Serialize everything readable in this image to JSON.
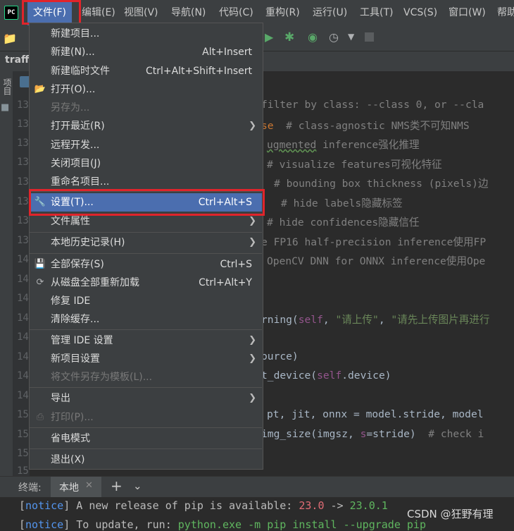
{
  "app": {
    "logo": "PC"
  },
  "menubar": {
    "items": [
      "文件(F)",
      "编辑(E)",
      "视图(V)",
      "导航(N)",
      "代码(C)",
      "重构(R)",
      "运行(U)",
      "工具(T)",
      "VCS(S)",
      "窗口(W)",
      "帮助"
    ]
  },
  "nav": {
    "project": "traff"
  },
  "sidebar": {
    "project_tab": "项目"
  },
  "gutter": {
    "lines": [
      "13",
      "13",
      "13",
      "13",
      "13",
      "13",
      "13",
      "13",
      "14",
      "14",
      "14",
      "14",
      "14",
      "14",
      "14",
      "14",
      "15",
      "15",
      "15",
      "15"
    ]
  },
  "code": {
    "l1": "filter by class: --class 0, or --cla",
    "l2a": "se",
    "l2b": "  # class-agnostic NMS类不可知NMS",
    "l3a": "ugmented",
    "l3b": " inference强化推理",
    "l4": "# visualize features可视化特征",
    "l5": "# bounding box thickness (pixels)边",
    "l6": "# hide labels隐藏标签",
    "l7": "# hide confidences隐藏信任",
    "l8": "e FP16 half-precision inference使用FP",
    "l9": "OpenCV DNN for ONNX inference使用Ope",
    "l10a": "rning(",
    "l10b": "self",
    "l10c": ", ",
    "l10d": "\"请上传\"",
    "l10e": ", ",
    "l10f": "\"请先上传图片再进行",
    "l11": "ource)",
    "l12a": "t_device(",
    "l12b": "self",
    "l12c": ".device)",
    "l13": "pt, jit, onnx = model.stride, model",
    "l14a": "img_size(imgsz, ",
    "l14b": "s",
    "l14c": "=stride)  ",
    "l14d": "# check i"
  },
  "file_menu": {
    "items": [
      {
        "label": "新建项目...",
        "shortcut": ""
      },
      {
        "label": "新建(N)...",
        "shortcut": "Alt+Insert"
      },
      {
        "label": "新建临时文件",
        "shortcut": "Ctrl+Alt+Shift+Insert"
      },
      {
        "label": "打开(O)...",
        "shortcut": "",
        "icon": "folder-icon"
      },
      {
        "label": "另存为...",
        "shortcut": "",
        "disabled": true
      },
      {
        "label": "打开最近(R)",
        "shortcut": "",
        "submenu": true
      },
      {
        "label": "远程开发...",
        "shortcut": ""
      },
      {
        "label": "关闭项目(J)",
        "shortcut": ""
      },
      {
        "label": "重命名项目...",
        "shortcut": ""
      },
      {
        "label": "设置(T)...",
        "shortcut": "Ctrl+Alt+S",
        "icon": "wrench-icon",
        "selected": true
      },
      {
        "label": "文件属性",
        "shortcut": "",
        "submenu": true
      },
      {
        "label": "本地历史记录(H)",
        "shortcut": "",
        "submenu": true
      },
      {
        "label": "全部保存(S)",
        "shortcut": "Ctrl+S",
        "icon": "save-icon"
      },
      {
        "label": "从磁盘全部重新加载",
        "shortcut": "Ctrl+Alt+Y",
        "icon": "reload-icon"
      },
      {
        "label": "修复 IDE",
        "shortcut": ""
      },
      {
        "label": "清除缓存...",
        "shortcut": ""
      },
      {
        "label": "管理 IDE 设置",
        "shortcut": "",
        "submenu": true
      },
      {
        "label": "新项目设置",
        "shortcut": "",
        "submenu": true
      },
      {
        "label": "将文件另存为模板(L)...",
        "shortcut": "",
        "disabled": true
      },
      {
        "label": "导出",
        "shortcut": "",
        "submenu": true
      },
      {
        "label": "打印(P)...",
        "shortcut": "",
        "disabled": true,
        "icon": "print-icon"
      },
      {
        "label": "省电模式",
        "shortcut": ""
      },
      {
        "label": "退出(X)",
        "shortcut": ""
      }
    ]
  },
  "terminal": {
    "label": "终端:",
    "tab": "本地",
    "line1_tag": "notice",
    "line1_text": " A new release of pip is available: ",
    "line1_old": "23.0",
    "line1_arrow": " -> ",
    "line1_new": "23.0.1",
    "line2_tag": "notice",
    "line2_text": " To update, run: ",
    "line2_cmd": "python.exe -m pip install --upgrade pip"
  },
  "watermark": "CSDN @狂野有理",
  "colors": {
    "accent": "#4b6eaf",
    "highlight_box": "#e0242b",
    "background": "#2b2b2b",
    "panel": "#3c3f41"
  }
}
